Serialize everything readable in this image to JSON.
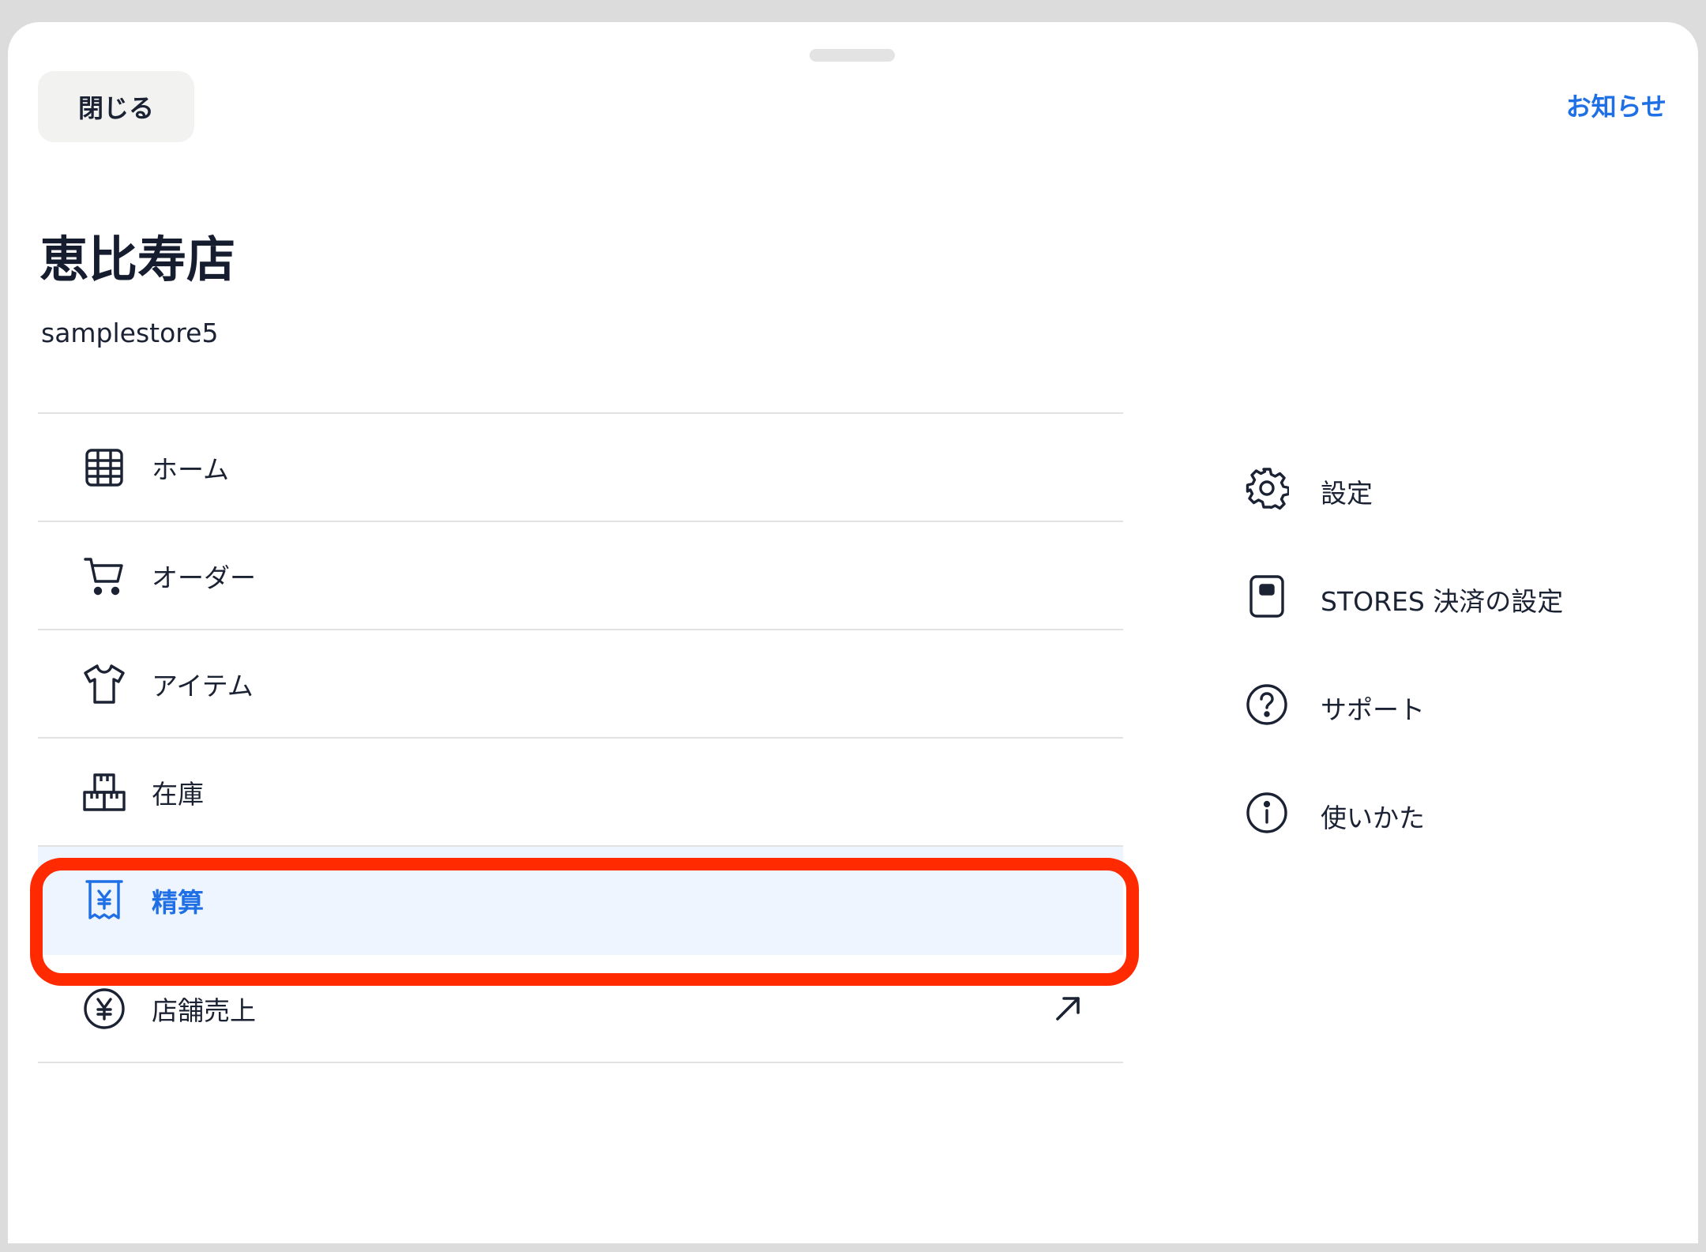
{
  "header": {
    "close_label": "閉じる",
    "news_label": "お知らせ"
  },
  "store": {
    "name": "恵比寿店",
    "id": "samplestore5"
  },
  "nav": {
    "items": [
      {
        "label": "ホーム",
        "icon": "grid-icon"
      },
      {
        "label": "オーダー",
        "icon": "cart-icon"
      },
      {
        "label": "アイテム",
        "icon": "tshirt-icon"
      },
      {
        "label": "在庫",
        "icon": "boxes-icon"
      },
      {
        "label": "精算",
        "icon": "receipt-yen-icon",
        "active": true
      },
      {
        "label": "店舗売上",
        "icon": "yen-circle-icon",
        "external": true
      }
    ]
  },
  "side": {
    "items": [
      {
        "label": "設定",
        "icon": "gear-icon"
      },
      {
        "label": "STORES 決済の設定",
        "icon": "card-reader-icon"
      },
      {
        "label": "サポート",
        "icon": "question-circle-icon"
      },
      {
        "label": "使いかた",
        "icon": "info-circle-icon"
      }
    ]
  },
  "colors": {
    "accent": "#1f6fe5",
    "active_bg": "#eef5fe",
    "highlight": "#ff2a00",
    "text": "#1b2233"
  }
}
